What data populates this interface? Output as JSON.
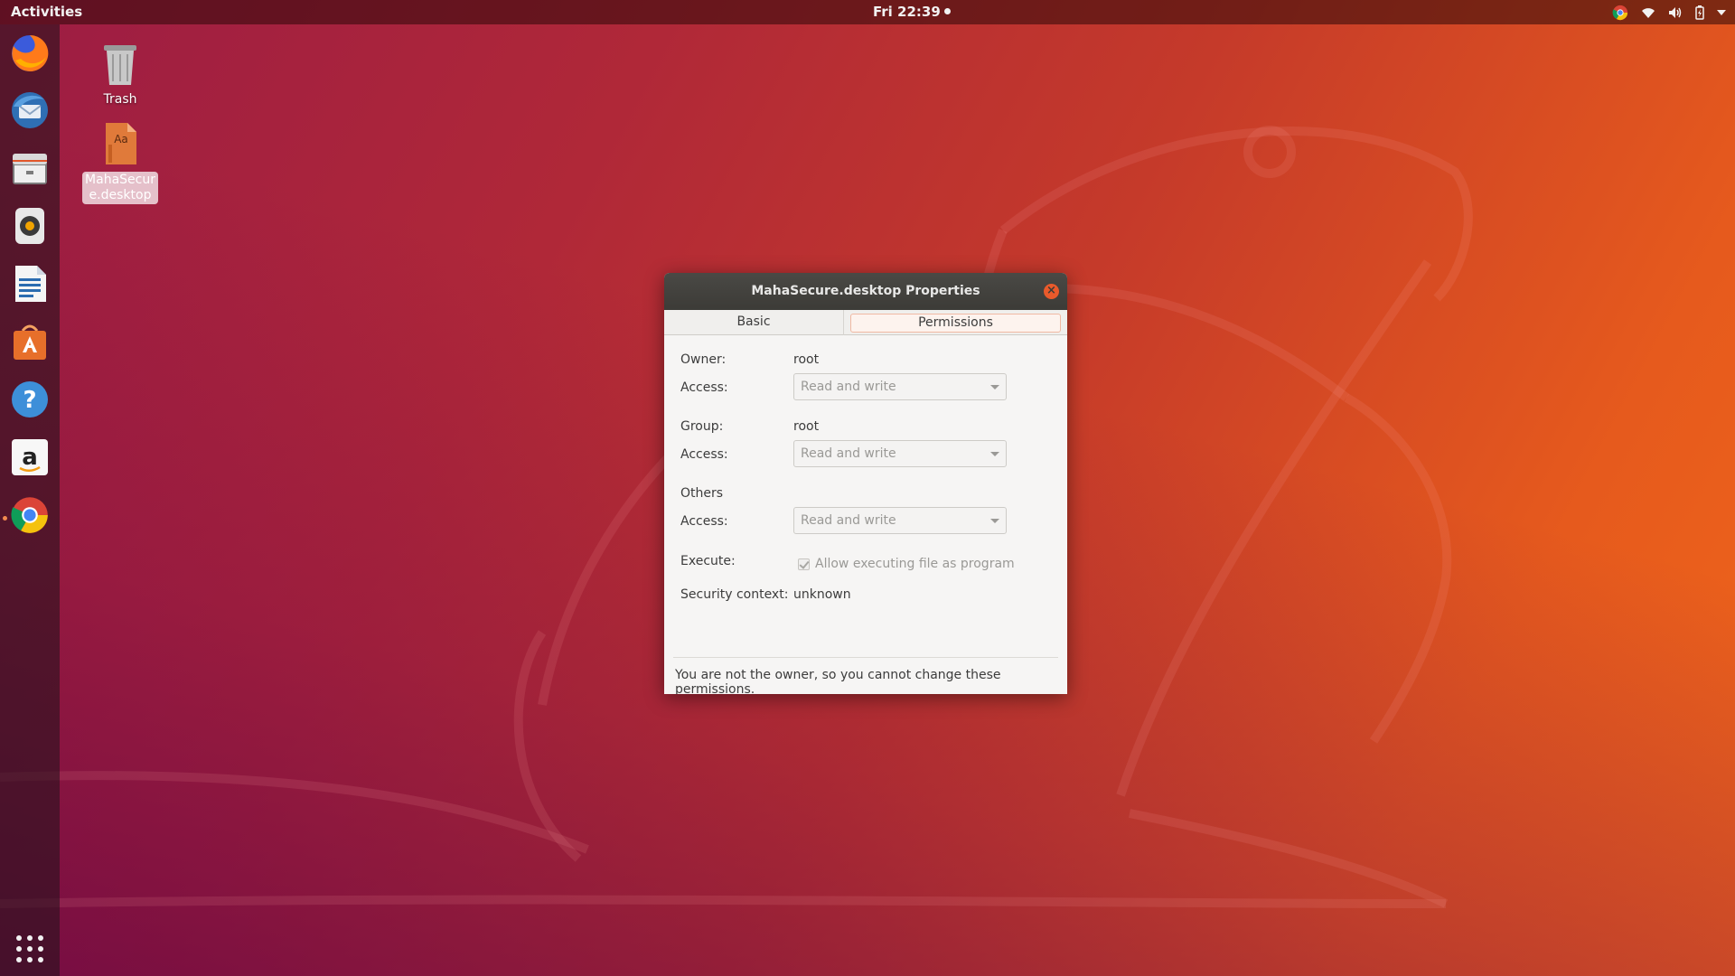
{
  "topbar": {
    "activities": "Activities",
    "clock": "Fri 22:39"
  },
  "tray_icons": [
    "chrome-icon",
    "wifi-icon",
    "volume-icon",
    "battery-icon",
    "menu-arrow-icon"
  ],
  "dock": {
    "items": [
      "firefox-icon",
      "thunderbird-icon",
      "files-icon",
      "rhythmbox-icon",
      "writer-icon",
      "software-icon",
      "help-icon",
      "amazon-icon",
      "chrome-icon"
    ],
    "show_apps": "show-apps-icon"
  },
  "desktop": {
    "trash_label": "Trash",
    "file_label": "MahaSecure.desktop"
  },
  "dialog": {
    "title": "MahaSecure.desktop Properties",
    "close": "×",
    "tabs": {
      "basic": "Basic",
      "permissions": "Permissions"
    },
    "owner_label": "Owner:",
    "owner_value": "root",
    "access_label": "Access:",
    "owner_access": "Read and write",
    "group_label": "Group:",
    "group_value": "root",
    "group_access": "Read and write",
    "others_label": "Others",
    "others_access": "Read and write",
    "execute_label": "Execute:",
    "execute_text": "Allow executing file as program",
    "security_label": "Security context:",
    "security_value": "unknown",
    "footer": "You are not the owner, so you cannot change these permissions."
  },
  "colors": {
    "accent": "#e95420",
    "titlebar": "#3c3b37",
    "dialog_bg": "#f6f5f4"
  }
}
